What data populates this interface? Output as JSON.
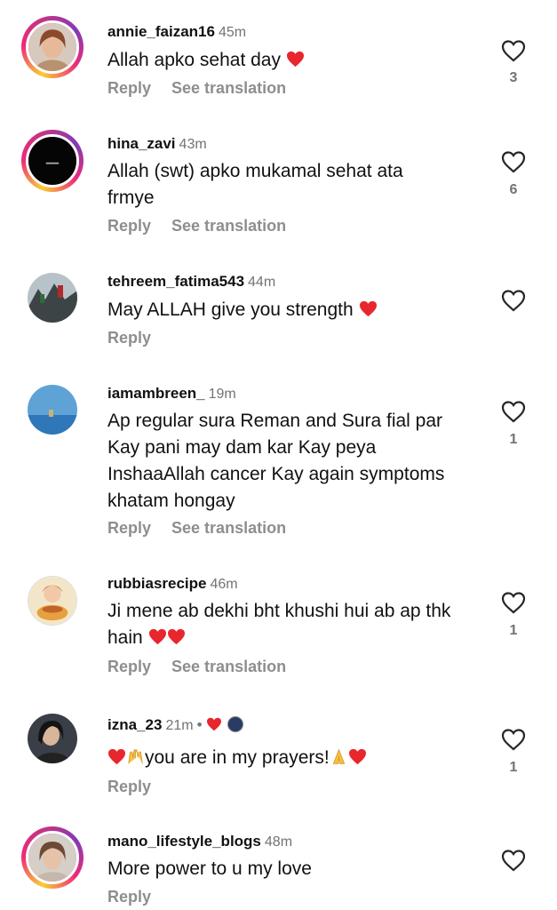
{
  "comments": [
    {
      "username": "annie_faizan16",
      "time": "45m",
      "text": "Allah apko sehat day",
      "likes": "3",
      "reply": "Reply",
      "translate": "See translation"
    },
    {
      "username": "hina_zavi",
      "time": "43m",
      "text": "Allah (swt) apko mukamal sehat ata frmye",
      "likes": "6",
      "reply": "Reply",
      "translate": "See translation"
    },
    {
      "username": "tehreem_fatima543",
      "time": "44m",
      "text": "May ALLAH give you strength",
      "likes": "",
      "reply": "Reply"
    },
    {
      "username": "iamambreen_",
      "time": "19m",
      "text": "Ap regular sura Reman and Sura fial par Kay pani may dam kar Kay peya InshaaAllah cancer Kay again symptoms khatam hongay",
      "likes": "1",
      "reply": "Reply",
      "translate": "See translation"
    },
    {
      "username": "rubbiasrecipe",
      "time": "46m",
      "text": "Ji mene ab dekhi bht khushi hui ab ap thk hain",
      "likes": "1",
      "reply": "Reply",
      "translate": "See translation"
    },
    {
      "username": "izna_23",
      "time": "21m",
      "text": "you are in my prayers!",
      "likes": "1",
      "reply": "Reply",
      "separator": "•"
    },
    {
      "username": "mano_lifestyle_blogs",
      "time": "48m",
      "text": "More power to u my love",
      "likes": "",
      "reply": "Reply"
    }
  ],
  "icons": {
    "like": "heart-outline-icon",
    "emoji_heart": "red-heart-emoji",
    "emoji_raised_hands": "raised-hands-emoji",
    "emoji_pray": "folded-hands-emoji"
  },
  "colors": {
    "muted": "#737373",
    "action": "#8e8e8e",
    "heart": "#e8262d"
  }
}
